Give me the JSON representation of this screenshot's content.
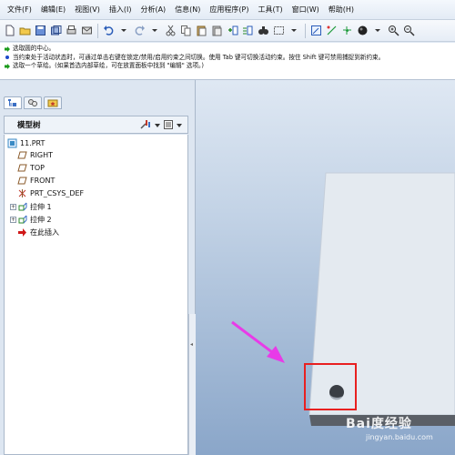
{
  "menu": {
    "items": [
      {
        "label": "文件(F)"
      },
      {
        "label": "编辑(E)"
      },
      {
        "label": "视图(V)"
      },
      {
        "label": "插入(I)"
      },
      {
        "label": "分析(A)"
      },
      {
        "label": "信息(N)"
      },
      {
        "label": "应用程序(P)"
      },
      {
        "label": "工具(T)"
      },
      {
        "label": "窗口(W)"
      },
      {
        "label": "帮助(H)"
      }
    ]
  },
  "messages": [
    {
      "text": "选取圆的中心。",
      "icon": "arrow-icon",
      "color": "#1a9a1a"
    },
    {
      "text": "当约束处于活动状态时，可通过单击右键在锁定/禁用/启用约束之间切换。使用 Tab 键可切换活动约束。按住 Shift 键可禁用捕捉到新约束。",
      "icon": "dot-icon",
      "color": "#1c48c9"
    },
    {
      "text": "选取一个草绘。(如果首选内部草绘，可在放置面板中找到 \"编辑\" 选项。)",
      "icon": "arrow-icon",
      "color": "#1a9a1a"
    }
  ],
  "tree": {
    "title": "模型树",
    "nodes": [
      {
        "label": "11.PRT",
        "icon": "part-icon"
      },
      {
        "label": "RIGHT",
        "icon": "datum-plane-icon"
      },
      {
        "label": "TOP",
        "icon": "datum-plane-icon"
      },
      {
        "label": "FRONT",
        "icon": "datum-plane-icon"
      },
      {
        "label": "PRT_CSYS_DEF",
        "icon": "csys-icon"
      },
      {
        "label": "拉伸 1",
        "icon": "extrude-icon"
      },
      {
        "label": "拉伸 2",
        "icon": "extrude-icon"
      },
      {
        "label": "在此插入",
        "icon": "insert-here-icon"
      }
    ]
  },
  "watermark": {
    "main": "Bai度经验",
    "sub": "jingyan.baidu.com"
  },
  "colors": {
    "annotation_arrow": "#e83be8",
    "highlight_box": "#e82020",
    "part_face": "#e4eaf0"
  }
}
